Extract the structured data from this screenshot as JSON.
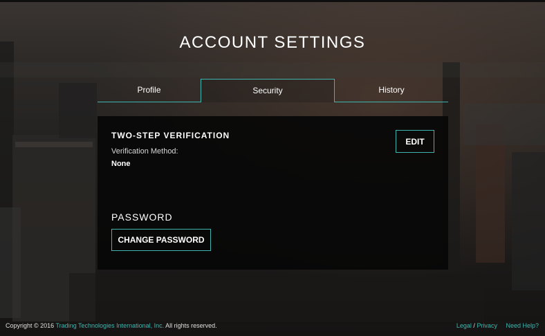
{
  "header": {
    "title": "ACCOUNT SETTINGS"
  },
  "tabs": [
    {
      "label": "Profile"
    },
    {
      "label": "Security"
    },
    {
      "label": "History"
    }
  ],
  "two_step": {
    "title": "TWO-STEP VERIFICATION",
    "method_label": "Verification Method:",
    "method_value": "None",
    "edit_label": "EDIT"
  },
  "password": {
    "title": "PASSWORD",
    "change_label": "CHANGE PASSWORD"
  },
  "footer": {
    "copyright_prefix": "Copyright © 2016 ",
    "company_link": "Trading Technologies International, Inc.",
    "copyright_suffix": " All rights reserved.",
    "legal": "Legal",
    "separator": " / ",
    "privacy": "Privacy",
    "help": "Need Help?"
  },
  "colors": {
    "accent": "#3fb7b0",
    "panel": "#080808"
  }
}
